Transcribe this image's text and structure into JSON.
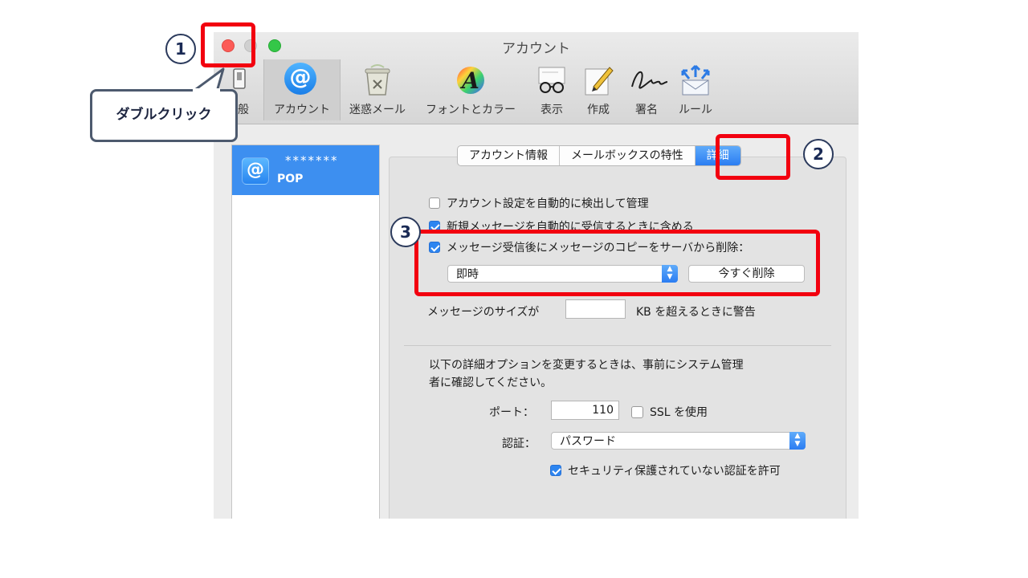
{
  "window": {
    "title": "アカウント",
    "toolbar": [
      {
        "label": "般",
        "icon": "switch-icon"
      },
      {
        "label": "アカウント",
        "icon": "at-icon"
      },
      {
        "label": "迷惑メール",
        "icon": "junk-trash-icon"
      },
      {
        "label": "フォントとカラー",
        "icon": "font-color-icon"
      },
      {
        "label": "表示",
        "icon": "glasses-icon"
      },
      {
        "label": "作成",
        "icon": "pencil-icon"
      },
      {
        "label": "署名",
        "icon": "signature-icon"
      },
      {
        "label": "ルール",
        "icon": "rules-envelope-icon"
      }
    ]
  },
  "sidebar": {
    "account_name": "*******",
    "account_type": "POP"
  },
  "tabs": [
    "アカウント情報",
    "メールボックスの特性",
    "詳細"
  ],
  "settings": {
    "auto_detect": {
      "label": "アカウント設定を自動的に検出して管理",
      "checked": false
    },
    "include_new": {
      "label": "新規メッセージを自動的に受信するときに含める",
      "checked": true
    },
    "delete_copy": {
      "label": "メッセージ受信後にメッセージのコピーをサーバから削除：",
      "checked": true
    },
    "delete_timing": "即時",
    "delete_now": "今すぐ削除",
    "size_warning_prefix": "メッセージのサイズが",
    "size_warning_value": "",
    "size_warning_suffix": "KB を超えるときに警告",
    "advanced_note_line1": "以下の詳細オプションを変更するときは、事前にシステム管理",
    "advanced_note_line2": "者に確認してください。",
    "port_label": "ポート：",
    "port_value": "110",
    "ssl_label": "SSL を使用",
    "ssl_checked": false,
    "auth_label": "認証：",
    "auth_value": "パスワード",
    "insecure_auth": {
      "label": "セキュリティ保護されていない認証を許可",
      "checked": true
    }
  },
  "annotations": {
    "step1": "1",
    "step2": "2",
    "step3": "3",
    "callout": "ダブルクリック",
    "highlight_color": "#f2000f"
  },
  "colors": {
    "accent_blue": "#2b7df2",
    "sidebar_selected": "#3d8ff0"
  }
}
